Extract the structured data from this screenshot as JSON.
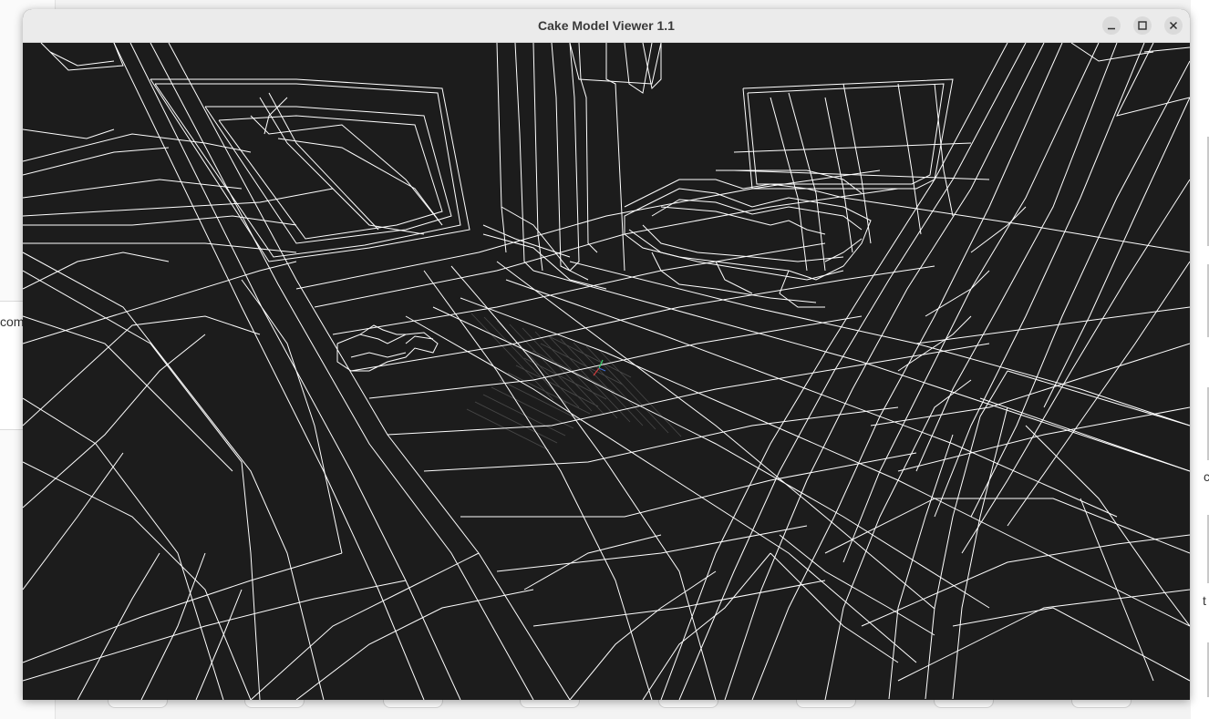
{
  "window": {
    "title": "Cake Model Viewer 1.1"
  },
  "titlebar_buttons": [
    {
      "name": "minimize",
      "icon": "minimize-icon"
    },
    {
      "name": "maximize",
      "icon": "maximize-icon"
    },
    {
      "name": "close",
      "icon": "close-icon"
    }
  ],
  "viewport": {
    "render_mode": "wireframe",
    "background_color": "#1c1c1c",
    "line_color": "#ffffff",
    "grid_color": "#4a4a4a",
    "origin_axes": [
      "x-axis-red",
      "y-axis-green",
      "z-axis-blue"
    ]
  },
  "background_window": {
    "fragment_left": "com",
    "fragment_right_1": "c",
    "fragment_right_2": "t"
  }
}
